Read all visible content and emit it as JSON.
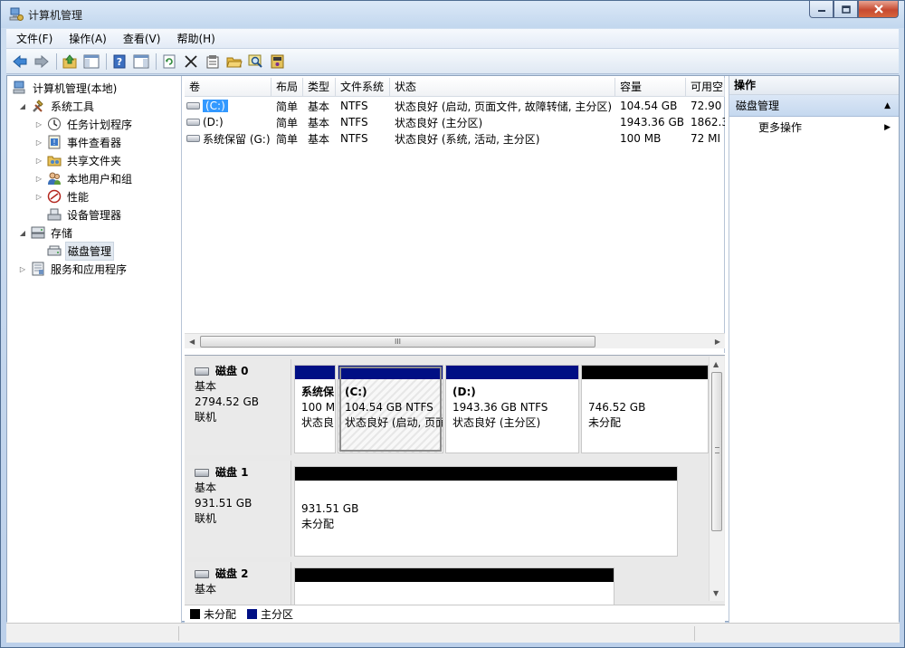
{
  "window": {
    "title": "计算机管理"
  },
  "menu": [
    "文件(F)",
    "操作(A)",
    "查看(V)",
    "帮助(H)"
  ],
  "toolbar": [
    "back-icon",
    "forward-icon",
    "up-folder-icon",
    "show-hide-tree-icon",
    "help-icon",
    "show-hide-action-pane-icon",
    "refresh-icon",
    "delete-icon",
    "properties-icon",
    "open-icon",
    "search-icon",
    "export-icon"
  ],
  "tree": {
    "root": "计算机管理(本地)",
    "system_tools": "系统工具",
    "task_scheduler": "任务计划程序",
    "event_viewer": "事件查看器",
    "shared_folders": "共享文件夹",
    "local_users": "本地用户和组",
    "performance": "性能",
    "device_manager": "设备管理器",
    "storage": "存储",
    "disk_management": "磁盘管理",
    "services_apps": "服务和应用程序"
  },
  "volume_list": {
    "headers": [
      "卷",
      "布局",
      "类型",
      "文件系统",
      "状态",
      "容量",
      "可用空"
    ],
    "rows": [
      [
        "(C:)",
        "简单",
        "基本",
        "NTFS",
        "状态良好 (启动, 页面文件, 故障转储, 主分区)",
        "104.54 GB",
        "72.90"
      ],
      [
        "(D:)",
        "简单",
        "基本",
        "NTFS",
        "状态良好 (主分区)",
        "1943.36 GB",
        "1862.3"
      ],
      [
        "系统保留 (G:)",
        "简单",
        "基本",
        "NTFS",
        "状态良好 (系统, 活动, 主分区)",
        "100 MB",
        "72 MI"
      ]
    ],
    "scroll_grip": "III"
  },
  "disks": [
    {
      "name": "磁盘 0",
      "type": "基本",
      "size": "2794.52 GB",
      "status": "联机",
      "partitions": [
        {
          "name": "系统保",
          "line1": "100 M",
          "line2": "状态良"
        },
        {
          "name": "(C:)",
          "line1": "104.54 GB NTFS",
          "line2": "状态良好 (启动, 页面"
        },
        {
          "name": "(D:)",
          "line1": "1943.36 GB NTFS",
          "line2": "状态良好 (主分区)"
        },
        {
          "name": "",
          "line1": "746.52 GB",
          "line2": "未分配"
        }
      ]
    },
    {
      "name": "磁盘 1",
      "type": "基本",
      "size": "931.51 GB",
      "status": "联机",
      "partitions": [
        {
          "name": "",
          "line1": "931.51 GB",
          "line2": "未分配"
        }
      ]
    },
    {
      "name": "磁盘 2",
      "type": "基本",
      "size": "",
      "status": "",
      "partitions": []
    }
  ],
  "legend": {
    "unallocated": "未分配",
    "primary": "主分区"
  },
  "colors": {
    "unallocated": "#000000",
    "primary": "#000f84"
  },
  "actions": {
    "header": "操作",
    "section": "磁盘管理",
    "more": "更多操作"
  }
}
